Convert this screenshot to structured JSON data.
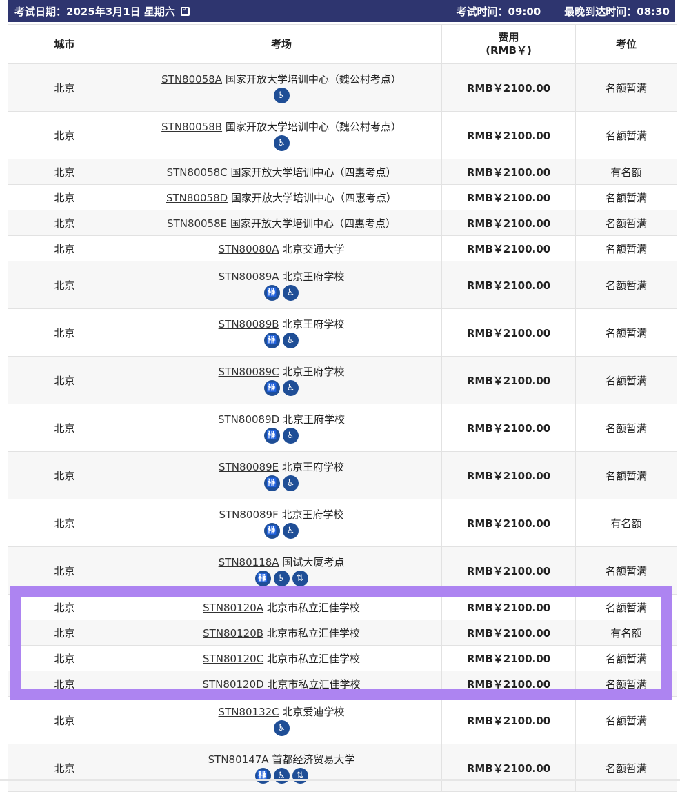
{
  "header": {
    "date_label": "考试日期：",
    "date_value": "2025年3月1日 星期六",
    "exam_time": "考试时间：09:00",
    "arrive_time": "最晚到达时间：08:30",
    "calendar_icon": "calendar-check-icon"
  },
  "columns": [
    "城市",
    "考场",
    "费用\n(RMB￥)",
    "考位"
  ],
  "icon_names": {
    "restroom": "restroom-icon",
    "wheelchair": "wheelchair-icon",
    "elevator": "elevator-icon"
  },
  "rows": [
    {
      "city": "北京",
      "code": "STN80058A",
      "name": "国家开放大学培训中心（魏公村考点）",
      "fee": "RMB￥2100.00",
      "seat": "名额暂满",
      "icons": [
        "wheelchair"
      ]
    },
    {
      "city": "北京",
      "code": "STN80058B",
      "name": "国家开放大学培训中心（魏公村考点）",
      "fee": "RMB￥2100.00",
      "seat": "名额暂满",
      "icons": [
        "wheelchair"
      ]
    },
    {
      "city": "北京",
      "code": "STN80058C",
      "name": "国家开放大学培训中心（四惠考点）",
      "fee": "RMB￥2100.00",
      "seat": "有名额",
      "icons": []
    },
    {
      "city": "北京",
      "code": "STN80058D",
      "name": "国家开放大学培训中心（四惠考点）",
      "fee": "RMB￥2100.00",
      "seat": "名额暂满",
      "icons": []
    },
    {
      "city": "北京",
      "code": "STN80058E",
      "name": "国家开放大学培训中心（四惠考点）",
      "fee": "RMB￥2100.00",
      "seat": "名额暂满",
      "icons": []
    },
    {
      "city": "北京",
      "code": "STN80080A",
      "name": "北京交通大学",
      "fee": "RMB￥2100.00",
      "seat": "名额暂满",
      "icons": []
    },
    {
      "city": "北京",
      "code": "STN80089A",
      "name": "北京王府学校",
      "fee": "RMB￥2100.00",
      "seat": "名额暂满",
      "icons": [
        "restroom",
        "wheelchair"
      ]
    },
    {
      "city": "北京",
      "code": "STN80089B",
      "name": "北京王府学校",
      "fee": "RMB￥2100.00",
      "seat": "名额暂满",
      "icons": [
        "restroom",
        "wheelchair"
      ]
    },
    {
      "city": "北京",
      "code": "STN80089C",
      "name": "北京王府学校",
      "fee": "RMB￥2100.00",
      "seat": "名额暂满",
      "icons": [
        "restroom",
        "wheelchair"
      ]
    },
    {
      "city": "北京",
      "code": "STN80089D",
      "name": "北京王府学校",
      "fee": "RMB￥2100.00",
      "seat": "名额暂满",
      "icons": [
        "restroom",
        "wheelchair"
      ]
    },
    {
      "city": "北京",
      "code": "STN80089E",
      "name": "北京王府学校",
      "fee": "RMB￥2100.00",
      "seat": "名额暂满",
      "icons": [
        "restroom",
        "wheelchair"
      ]
    },
    {
      "city": "北京",
      "code": "STN80089F",
      "name": "北京王府学校",
      "fee": "RMB￥2100.00",
      "seat": "有名额",
      "icons": [
        "restroom",
        "wheelchair"
      ]
    },
    {
      "city": "北京",
      "code": "STN80118A",
      "name": "国试大厦考点",
      "fee": "RMB￥2100.00",
      "seat": "名额暂满",
      "icons": [
        "restroom",
        "wheelchair",
        "elevator"
      ]
    },
    {
      "city": "北京",
      "code": "STN80120A",
      "name": "北京市私立汇佳学校",
      "fee": "RMB￥2100.00",
      "seat": "名额暂满",
      "icons": []
    },
    {
      "city": "北京",
      "code": "STN80120B",
      "name": "北京市私立汇佳学校",
      "fee": "RMB￥2100.00",
      "seat": "有名额",
      "icons": []
    },
    {
      "city": "北京",
      "code": "STN80120C",
      "name": "北京市私立汇佳学校",
      "fee": "RMB￥2100.00",
      "seat": "名额暂满",
      "icons": []
    },
    {
      "city": "北京",
      "code": "STN80120D",
      "name": "北京市私立汇佳学校",
      "fee": "RMB￥2100.00",
      "seat": "名额暂满",
      "icons": []
    },
    {
      "city": "北京",
      "code": "STN80132C",
      "name": "北京爱迪学校",
      "fee": "RMB￥2100.00",
      "seat": "名额暂满",
      "icons": [
        "wheelchair"
      ]
    },
    {
      "city": "北京",
      "code": "STN80147A",
      "name": "首都经济贸易大学",
      "fee": "RMB￥2100.00",
      "seat": "名额暂满",
      "icons": [
        "restroom",
        "wheelchair",
        "elevator"
      ]
    }
  ],
  "colors": {
    "header_bg": "#2e356f",
    "icon_bg": "#1f4e96",
    "highlight": "#ad84f1"
  }
}
